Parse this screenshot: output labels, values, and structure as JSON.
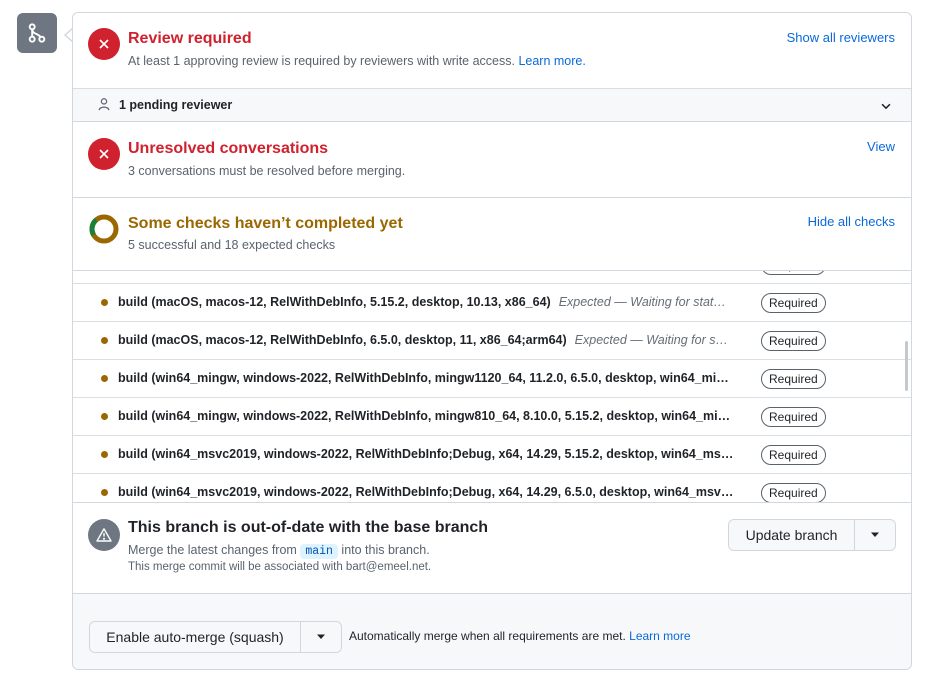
{
  "review": {
    "title": "Review required",
    "description": "At least 1 approving review is required by reviewers with write access.",
    "learn_more": "Learn more.",
    "action": "Show all reviewers",
    "pending": "1 pending reviewer"
  },
  "conversations": {
    "title": "Unresolved conversations",
    "description": "3 conversations must be resolved before merging.",
    "action": "View"
  },
  "checks": {
    "title": "Some checks haven’t completed yet",
    "description": "5 successful and 18 expected checks",
    "action": "Hide all checks",
    "required_label": "Required",
    "progress": {
      "successful": 5,
      "expected": 18
    },
    "items": [
      {
        "name": "build (macOS, macos-12, RelWithDebInfo, 5.15.2, desktop, 10.13, x86_64)",
        "desc": "Expected — Waiting for stat…"
      },
      {
        "name": "build (macOS, macos-12, RelWithDebInfo, 6.5.0, desktop, 11, x86_64;arm64)",
        "desc": "Expected — Waiting for s…"
      },
      {
        "name": "build (win64_mingw, windows-2022, RelWithDebInfo, mingw1120_64, 11.2.0, 6.5.0, desktop, win64_mi…",
        "desc": ""
      },
      {
        "name": "build (win64_mingw, windows-2022, RelWithDebInfo, mingw810_64, 8.10.0, 5.15.2, desktop, win64_mi…",
        "desc": ""
      },
      {
        "name": "build (win64_msvc2019, windows-2022, RelWithDebInfo;Debug, x64, 14.29, 5.15.2, desktop, win64_ms…",
        "desc": ""
      },
      {
        "name": "build (win64_msvc2019, windows-2022, RelWithDebInfo;Debug, x64, 14.29, 6.5.0, desktop, win64_msv…",
        "desc": ""
      }
    ]
  },
  "branch": {
    "title": "This branch is out-of-date with the base branch",
    "merge_prefix": "Merge the latest changes from",
    "base_branch": "main",
    "merge_suffix": "into this branch.",
    "commit_note": "This merge commit will be associated with bart@emeel.net.",
    "update_button": "Update branch"
  },
  "auto_merge": {
    "button": "Enable auto-merge (squash)",
    "hint": "Automatically merge when all requirements are met.",
    "learn_more": "Learn more"
  },
  "colors": {
    "danger": "#cf222e",
    "attention": "#9a6700",
    "success": "#1a7f37",
    "accent": "#0969da"
  }
}
